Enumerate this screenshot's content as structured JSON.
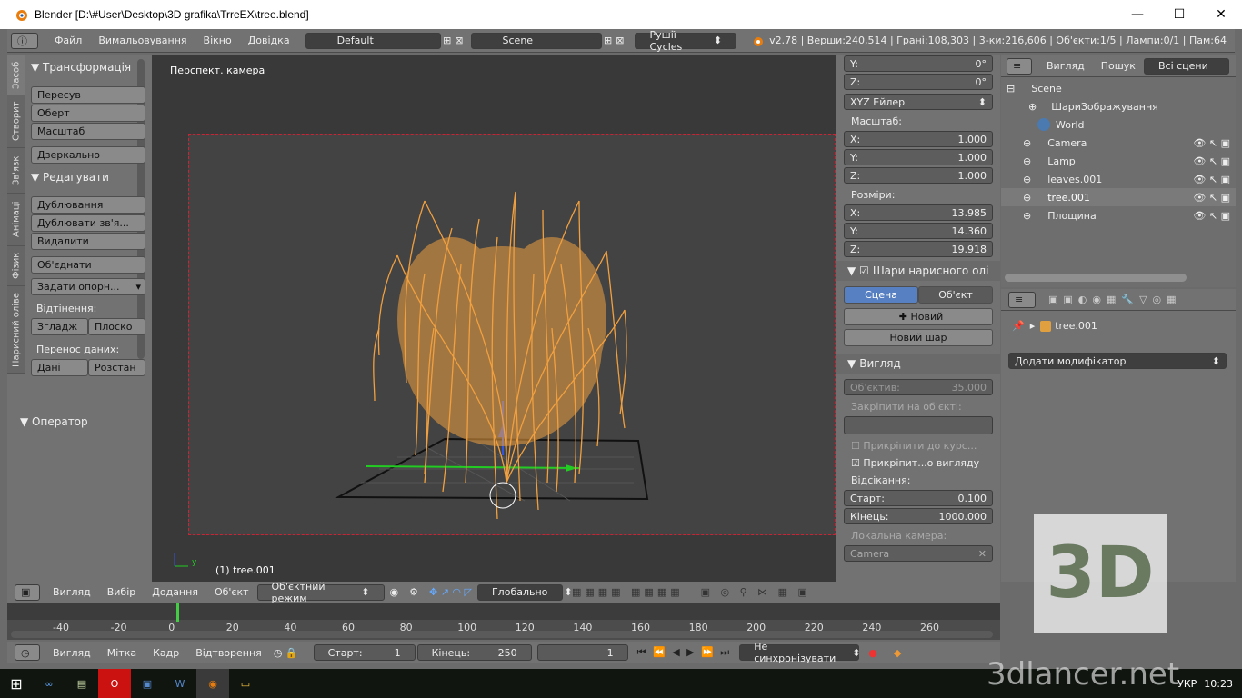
{
  "window": {
    "title": "Blender [D:\\#User\\Desktop\\3D grafika\\TrreEX\\tree.blend]",
    "min": "—",
    "max": "☐",
    "close": "✕"
  },
  "header": {
    "menu": [
      "Файл",
      "Вимальовування",
      "Вікно",
      "Довідка"
    ],
    "layout": "Default",
    "scene": "Scene",
    "engine": "Рушії Cycles",
    "stats": "v2.78 | Верши:240,514 | Грані:108,303 | 3-ки:216,606 | Об'єкти:1/5 | Лампи:0/1 | Пам:64"
  },
  "tool_shelf": {
    "tabs": [
      "Засоб",
      "Створит",
      "Зв'язк",
      "Анімаці",
      "Фізик",
      "Нарисний олівe"
    ],
    "transform_title": "Трансформація",
    "transform": [
      "Пересув",
      "Оберт",
      "Масштаб"
    ],
    "mirror": "Дзеркально",
    "edit_title": "Редагувати",
    "edit": [
      "Дублювання",
      "Дублювати зв'я...",
      "Видалити"
    ],
    "join": "Об'єднати",
    "origin": "Задати опорн...",
    "shading_label": "Відтінення:",
    "shading": [
      "Згладж",
      "Плоско"
    ],
    "data_label": "Перенос даних:",
    "data": [
      "Дані",
      "Розстан"
    ],
    "operator": "Оператор"
  },
  "viewport": {
    "view_label": "Перспект. камера",
    "object_label": "(1) tree.001",
    "menu": [
      "Вигляд",
      "Вибір",
      "Додання",
      "Об'єкт"
    ],
    "mode": "Об'єктний режим",
    "orientation": "Глобально"
  },
  "properties": {
    "rot_y": {
      "label": "Y:",
      "value": "0°"
    },
    "rot_z": {
      "label": "Z:",
      "value": "0°"
    },
    "rot_mode": "XYZ Ейлер",
    "scale_label": "Масштаб:",
    "scale": [
      {
        "label": "X:",
        "value": "1.000"
      },
      {
        "label": "Y:",
        "value": "1.000"
      },
      {
        "label": "Z:",
        "value": "1.000"
      }
    ],
    "dims_label": "Розміри:",
    "dims": [
      {
        "label": "X:",
        "value": "13.985"
      },
      {
        "label": "Y:",
        "value": "14.360"
      },
      {
        "label": "Z:",
        "value": "19.918"
      }
    ],
    "gp_title": "Шари нарисного олі",
    "gp_tabs": [
      "Сцена",
      "Об'єкт"
    ],
    "gp_new": "Новий",
    "gp_new_layer": "Новий шар",
    "view_title": "Вигляд",
    "lens_label": "Об'єктив:",
    "lens_value": "35.000",
    "lock_obj": "Закріпити на об'єкті:",
    "lock_cursor": "Прикріпити до курс...",
    "lock_view": "Прикріпит...о вигляду",
    "clip_label": "Відсікання:",
    "clip_start": {
      "label": "Старт:",
      "value": "0.100"
    },
    "clip_end": {
      "label": "Кінець:",
      "value": "1000.000"
    },
    "local_cam": "Локальна камера:",
    "local_cam_value": "Camera"
  },
  "outliner": {
    "menu": [
      "Вигляд",
      "Пошук"
    ],
    "filter": "Всі сцени",
    "items": [
      {
        "name": "Scene",
        "indent": 0
      },
      {
        "name": "ШариЗображування",
        "indent": 1
      },
      {
        "name": "World",
        "indent": 1
      },
      {
        "name": "Camera",
        "indent": 1
      },
      {
        "name": "Lamp",
        "indent": 1
      },
      {
        "name": "leaves.001",
        "indent": 1
      },
      {
        "name": "tree.001",
        "indent": 1
      },
      {
        "name": "Площина",
        "indent": 1
      }
    ]
  },
  "modifiers": {
    "object": "tree.001",
    "add": "Додати модифікатор"
  },
  "timeline": {
    "ticks": [
      "-40",
      "-20",
      "0",
      "20",
      "40",
      "60",
      "80",
      "100",
      "120",
      "140",
      "160",
      "180",
      "200",
      "220",
      "240",
      "260"
    ],
    "menu": [
      "Вигляд",
      "Мітка",
      "Кадр",
      "Відтворення"
    ],
    "start": {
      "label": "Старт:",
      "value": "1"
    },
    "end": {
      "label": "Кінець:",
      "value": "250"
    },
    "current": "1",
    "sync": "Не синхронізувати"
  },
  "taskbar": {
    "lang": "УКР",
    "time": "10:23"
  },
  "watermark": {
    "big": "3D",
    "text": "3dlancer.net"
  }
}
